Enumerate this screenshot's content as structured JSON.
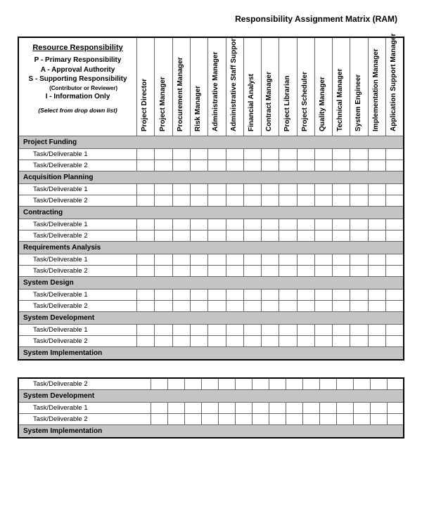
{
  "title": "Responsibility Assignment Matrix (RAM)",
  "legend": {
    "heading": "Resource Responsibility",
    "p": "P - Primary Responsibility",
    "a": "A - Approval Authority",
    "s": "S - Supporting Responsibility",
    "s_sub": "(Contributor or Reviewer)",
    "i": "I - Information Only",
    "hint": "(Select from drop down list)"
  },
  "roles": [
    "Project Director",
    "Project Manager",
    "Procurement Manager",
    "Risk Manager",
    "Administrative Manager",
    "Administrative Staff Support",
    "Financial Analyst",
    "Contract Manager",
    "Project Librarian",
    "Project Scheduler",
    "Quality Manager",
    "Technical Manager",
    "System Engineer",
    "Implementation Manager",
    "Application Support Manager"
  ],
  "sections_upper": [
    {
      "name": "Project Funding",
      "tasks": [
        "Task/Deliverable 1",
        "Task/Deliverable 2"
      ]
    },
    {
      "name": "Acquisition Planning",
      "tasks": [
        "Task/Deliverable 1",
        "Task/Deliverable 2"
      ]
    },
    {
      "name": "Contracting",
      "tasks": [
        "Task/Deliverable 1",
        "Task/Deliverable 2"
      ]
    },
    {
      "name": "Requirements Analysis",
      "tasks": [
        "Task/Deliverable 1",
        "Task/Deliverable 2"
      ]
    },
    {
      "name": "System Design",
      "tasks": [
        "Task/Deliverable 1",
        "Task/Deliverable 2"
      ]
    },
    {
      "name": "System Development",
      "tasks": [
        "Task/Deliverable 1",
        "Task/Deliverable 2"
      ]
    },
    {
      "name": "System Implementation",
      "tasks": []
    }
  ],
  "sections_lower": [
    {
      "name": null,
      "tasks": [
        "Task/Deliverable 2"
      ]
    },
    {
      "name": "System Development",
      "tasks": [
        "Task/Deliverable 1",
        "Task/Deliverable 2"
      ]
    },
    {
      "name": "System Implementation",
      "tasks": []
    }
  ]
}
